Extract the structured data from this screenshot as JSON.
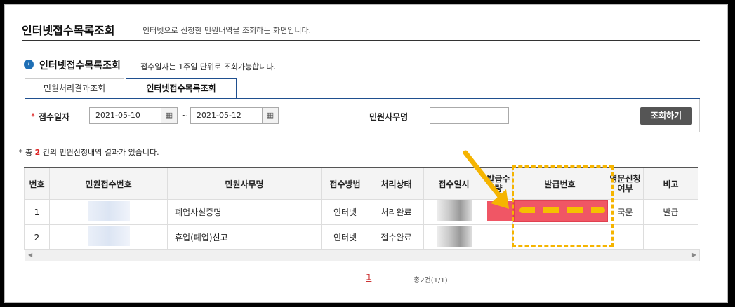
{
  "page": {
    "title": "인터넷접수목록조회",
    "description": "인터넷으로 신청한 민원내역을 조회하는 화면입니다."
  },
  "section": {
    "title": "인터넷접수목록조회",
    "description": "접수일자는 1주일 단위로 조회가능합니다."
  },
  "tabs": [
    {
      "label": "민원처리결과조회",
      "active": false
    },
    {
      "label": "인터넷접수목록조회",
      "active": true
    }
  ],
  "search": {
    "required_mark": "*",
    "date_label": "접수일자",
    "date_from": "2021-05-10",
    "date_to": "2021-05-12",
    "tilde": "~",
    "office_label": "민원사무명",
    "office_value": "",
    "button_label": "조회하기"
  },
  "result": {
    "prefix": "* 총",
    "count": "2",
    "suffix": "건의 민원신청내역 결과가 있습니다."
  },
  "table": {
    "headers": [
      "번호",
      "민원접수번호",
      "민원사무명",
      "접수방법",
      "처리상태",
      "접수일시",
      "발급수량",
      "발급번호",
      "영문신청여부",
      "비고"
    ],
    "rows": [
      {
        "no": "1",
        "office": "폐업사실증명",
        "method": "인터넷",
        "status": "처리완료",
        "qty": "",
        "english": "국문",
        "note": "발급"
      },
      {
        "no": "2",
        "office": "휴업(폐업)신고",
        "method": "인터넷",
        "status": "접수완료",
        "qty": "",
        "english": "",
        "note": ""
      }
    ]
  },
  "pagination": {
    "current": "1",
    "total_text": "총2건(1/1)"
  },
  "colors": {
    "accent": "#1f4f8f",
    "highlight": "#f5b400",
    "annotation_red": "#e01e32"
  }
}
